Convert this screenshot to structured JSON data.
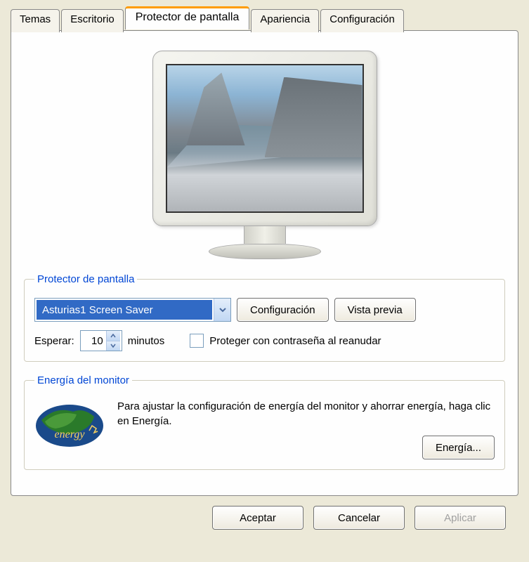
{
  "tabs": {
    "temas": "Temas",
    "escritorio": "Escritorio",
    "protector": "Protector de pantalla",
    "apariencia": "Apariencia",
    "configuracion": "Configuración"
  },
  "screensaver": {
    "legend": "Protector de pantalla",
    "selected": "Asturias1 Screen Saver",
    "config_btn": "Configuración",
    "preview_btn": "Vista previa",
    "wait_label": "Esperar:",
    "wait_value": "10",
    "wait_unit": "minutos",
    "password_label": "Proteger con contraseña al reanudar"
  },
  "energy": {
    "legend": "Energía del monitor",
    "text": "Para ajustar la configuración de energía del monitor y ahorrar energía, haga clic en Energía.",
    "btn": "Energía..."
  },
  "buttons": {
    "ok": "Aceptar",
    "cancel": "Cancelar",
    "apply": "Aplicar"
  }
}
